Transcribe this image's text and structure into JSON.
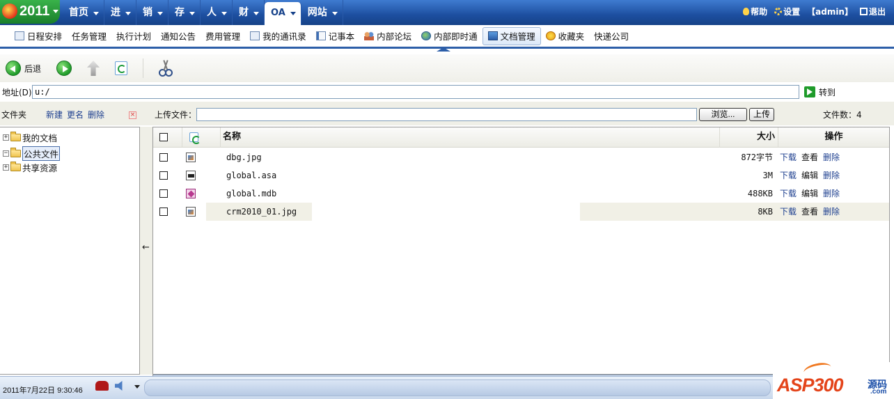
{
  "topnav": {
    "logo_text": "2011",
    "items": [
      {
        "label": "首页",
        "active": false
      },
      {
        "label": "进",
        "active": false
      },
      {
        "label": "销",
        "active": false
      },
      {
        "label": "存",
        "active": false
      },
      {
        "label": "人",
        "active": false
      },
      {
        "label": "财",
        "active": false
      },
      {
        "label": "OA",
        "active": true
      },
      {
        "label": "网站",
        "active": false
      }
    ],
    "help": "帮助",
    "settings": "设置",
    "user": "【admin】",
    "logout": "退出"
  },
  "modules": [
    {
      "label": "日程安排",
      "icon": "schedule-icon"
    },
    {
      "label": "任务管理",
      "icon": "task-icon"
    },
    {
      "label": "执行计划",
      "icon": "plan-icon"
    },
    {
      "label": "通知公告",
      "icon": "notice-icon"
    },
    {
      "label": "费用管理",
      "icon": "expense-icon"
    },
    {
      "label": "我的通讯录",
      "icon": "contacts-icon"
    },
    {
      "label": "记事本",
      "icon": "notepad-icon"
    },
    {
      "label": "内部论坛",
      "icon": "forum-icon"
    },
    {
      "label": "内部即时通",
      "icon": "messenger-icon"
    },
    {
      "label": "文档管理",
      "icon": "documents-icon",
      "active": true
    },
    {
      "label": "收藏夹",
      "icon": "favorites-icon"
    },
    {
      "label": "快递公司",
      "icon": "courier-icon"
    }
  ],
  "toolbar": {
    "back": "后退"
  },
  "address": {
    "label": "地址(D)",
    "value": "u:/",
    "go": "转到"
  },
  "folders": {
    "title": "文件夹",
    "new": "新建",
    "rename": "更名",
    "delete": "删除",
    "tree": [
      {
        "label": "我的文档",
        "expander": "+"
      },
      {
        "label": "公共文件",
        "expander": "−",
        "selected": true
      },
      {
        "label": "共享资源",
        "expander": "+"
      }
    ]
  },
  "upload": {
    "label": "上传文件：",
    "browse": "浏览...",
    "submit": "上传",
    "file_count": "文件数：4"
  },
  "table": {
    "columns": {
      "name": "名称",
      "size": "大小",
      "ops": "操作"
    },
    "rows": [
      {
        "name": "dbg.jpg",
        "size": "872字节",
        "type": "image",
        "op1": "下载",
        "op2": "查看",
        "op3": "删除"
      },
      {
        "name": "global.asa",
        "size": "3M",
        "type": "asa",
        "op1": "下载",
        "op2": "编辑",
        "op3": "删除"
      },
      {
        "name": "global.mdb",
        "size": "488KB",
        "type": "mdb",
        "op1": "下载",
        "op2": "编辑",
        "op3": "删除"
      },
      {
        "name": "crm2010_01.jpg",
        "size": "8KB",
        "type": "image",
        "op1": "下载",
        "op2": "查看",
        "op3": "删除"
      }
    ]
  },
  "statusbar": {
    "datetime": "2011年7月22日 9:30:46"
  },
  "watermark": {
    "brand": "ASP300",
    "cn": "源码",
    "domain": ".com"
  }
}
